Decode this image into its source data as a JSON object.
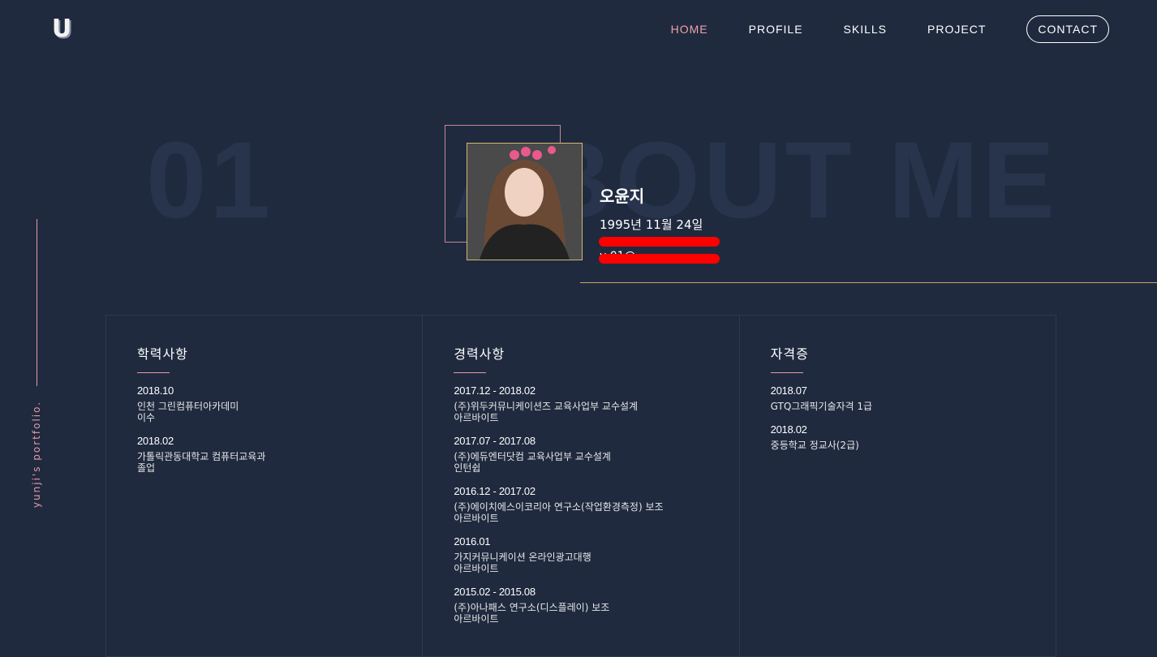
{
  "header": {
    "logo": "U",
    "nav": [
      "HOME",
      "PROFILE",
      "SKILLS",
      "PROJECT"
    ],
    "contact": "CONTACT"
  },
  "side": {
    "text": "yunji's portfolio."
  },
  "section": {
    "number": "01",
    "title": "ABOUT ME"
  },
  "profile": {
    "name": "오윤지",
    "birth": "1995년 11월 24일",
    "redacted_visible": "y    01@"
  },
  "panels": [
    {
      "title": "학력사항",
      "entries": [
        {
          "date": "2018.10",
          "desc": "인천 그린컴퓨터아카데미\n이수"
        },
        {
          "date": "2018.02",
          "desc": "가톨릭관동대학교 컴퓨터교육과\n졸업"
        }
      ]
    },
    {
      "title": "경력사항",
      "entries": [
        {
          "date": "2017.12 - 2018.02",
          "desc": "(주)위두커뮤니케이션즈 교육사업부 교수설계\n아르바이트"
        },
        {
          "date": "2017.07 - 2017.08",
          "desc": "(주)에듀엔터닷컴 교육사업부 교수설계\n인턴쉽"
        },
        {
          "date": "2016.12 - 2017.02",
          "desc": "(주)에이치에스이코리아 연구소(작업환경측정) 보조\n아르바이트"
        },
        {
          "date": "2016.01",
          "desc": "가지커뮤니케이션 온라인광고대행\n아르바이트"
        },
        {
          "date": "2015.02 - 2015.08",
          "desc": "(주)아나패스 연구소(디스플레이) 보조\n아르바이트"
        }
      ]
    },
    {
      "title": "자격증",
      "entries": [
        {
          "date": "2018.07",
          "desc": "GTQ그래픽기술자격 1급"
        },
        {
          "date": "2018.02",
          "desc": "중등학교 정교사(2급)"
        }
      ]
    }
  ]
}
